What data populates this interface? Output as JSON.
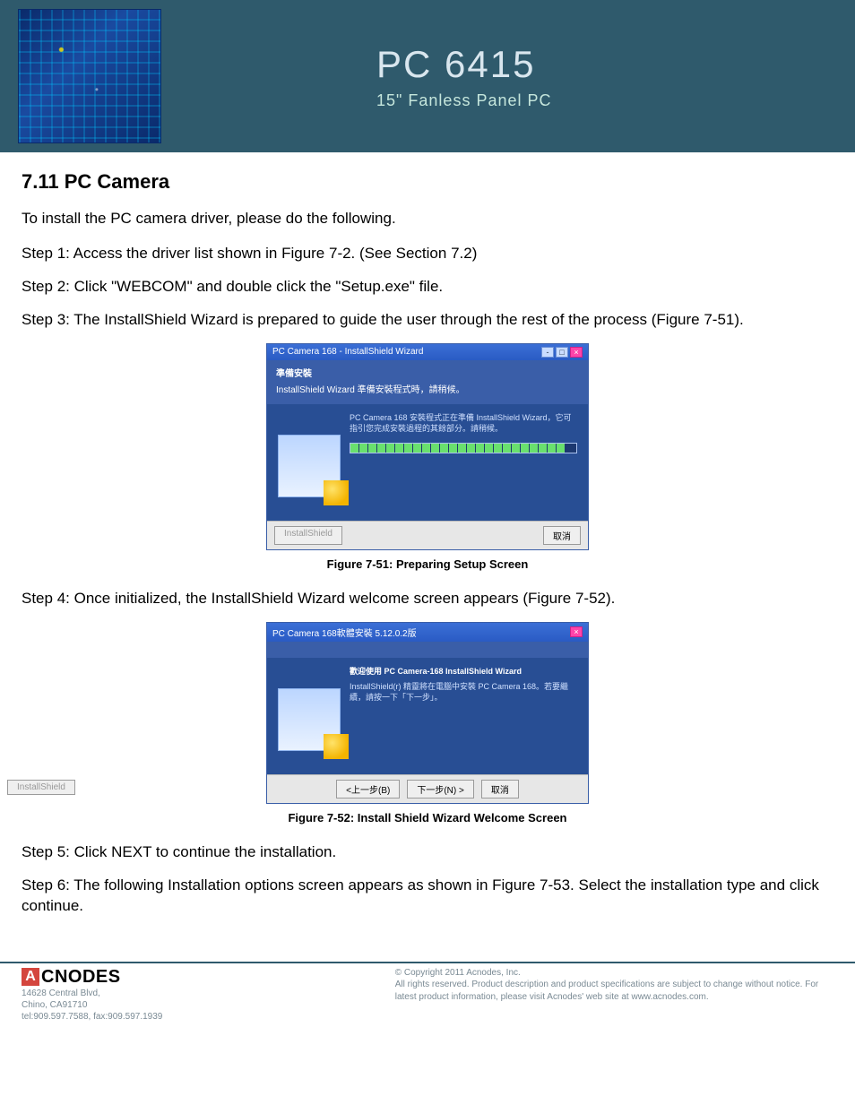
{
  "header": {
    "product": "PC 6415",
    "tagline": "15\" Fanless Panel PC"
  },
  "section": {
    "number": "7.11",
    "title": "PC Camera"
  },
  "intro": "To install the PC camera driver, please do the following.",
  "steps": {
    "s1": "Step 1:  Access the driver list shown in Figure 7-2. (See Section 7.2)",
    "s2": "Step 2:  Click \"WEBCOM\" and double click the \"Setup.exe\" file.",
    "s3": "Step 3:  The InstallShield Wizard is prepared to guide the user through the rest of the process (Figure 7-51).",
    "s4": "Step 4:  Once initialized, the InstallShield Wizard welcome screen appears (Figure 7-52).",
    "s5": "Step 5:  Click NEXT to continue the installation.",
    "s6": "Step 6:  The following Installation options screen appears as shown in Figure 7-53. Select the installation type and click continue."
  },
  "fig1": {
    "title": "PC Camera 168 - InstallShield Wizard",
    "sub1": "準備安裝",
    "sub2": "InstallShield Wizard 準備安裝程式時，請稍候。",
    "body": "PC Camera 168 安裝程式正在準備 InstallShield Wizard，它可指引您完成安裝過程的其餘部分。請稍候。",
    "btn_cancel": "取消",
    "caption": "Figure 7-51: Preparing Setup Screen"
  },
  "fig2": {
    "title": "PC Camera 168軟體安裝 5.12.0.2版",
    "body1": "歡迎使用 PC Camera-168 InstallShield Wizard",
    "body2": "InstallShield(r) 精靈將在電腦中安裝 PC Camera 168。若要繼續，請按一下「下一步」。",
    "btn_back": "<上一步(B)",
    "btn_next": "下一步(N) >",
    "btn_cancel": "取消",
    "caption": "Figure 7-52: Install Shield Wizard Welcome Screen"
  },
  "footer": {
    "logo_text": "CNODES",
    "addr1": "14628 Central Blvd,",
    "addr2": "Chino, CA91710",
    "addr3": "tel:909.597.7588, fax:909.597.1939",
    "copy1": "© Copyright 2011 Acnodes, Inc.",
    "copy2": "All rights reserved. Product description and product specifications are subject to change without notice. For latest product information, please visit Acnodes' web site at www.acnodes.com."
  }
}
